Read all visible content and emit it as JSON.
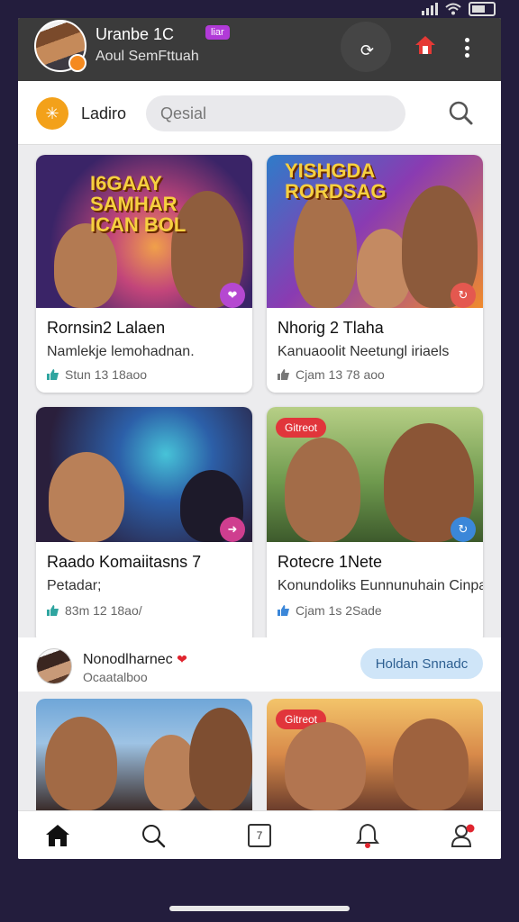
{
  "header": {
    "user_name": "Uranbe 1C",
    "badge": "liar",
    "subtitle": "Aoul SemFttuah"
  },
  "search": {
    "brand_label": "Ladiro",
    "placeholder": "Qesial"
  },
  "cards": [
    {
      "overlay": "I6GAAY\nSAMHAR\nICAN BOL",
      "title": "Rornsin2 Lalaen",
      "desc": "Namlekje lemohadnan.",
      "stats": "Stun 13 18aoo",
      "accent": "#b548d1"
    },
    {
      "overlay": "YISHGDA\nRORDSAG",
      "title": "Nhorig 2 Tlaha",
      "desc": "Kanuaoolit Neetungl iriaels",
      "stats": "Cjam 13 78 aoo",
      "accent": "#e4584f"
    },
    {
      "title": "Raado Komaiitasns 7",
      "desc": "Petadar;",
      "stats": "83m 12 18ao/",
      "accent": "#cf3e8f"
    },
    {
      "tag": "Gitreot",
      "title": "Rotecre 1Nete",
      "desc": "Konundoliks Eunnunuhain Cinpal.",
      "stats": "Cjam 1s 2Sade",
      "accent": "#3b87d9"
    }
  ],
  "suggestion": {
    "name": "Nonodlharnec",
    "sub": "Ocaatalboo",
    "follow_label": "Holdan Snnadc"
  },
  "lower_cards": [
    {
      "tag": ""
    },
    {
      "tag": "Gitreot"
    }
  ],
  "colors": {
    "topbar": "#3b3b3b",
    "accent_orange": "#f3a11a",
    "follow_bg": "#cfe5f8"
  },
  "nav": [
    "home-icon",
    "search-icon",
    "square-icon",
    "bell-icon",
    "profile-icon"
  ],
  "nav_square_label": "7"
}
